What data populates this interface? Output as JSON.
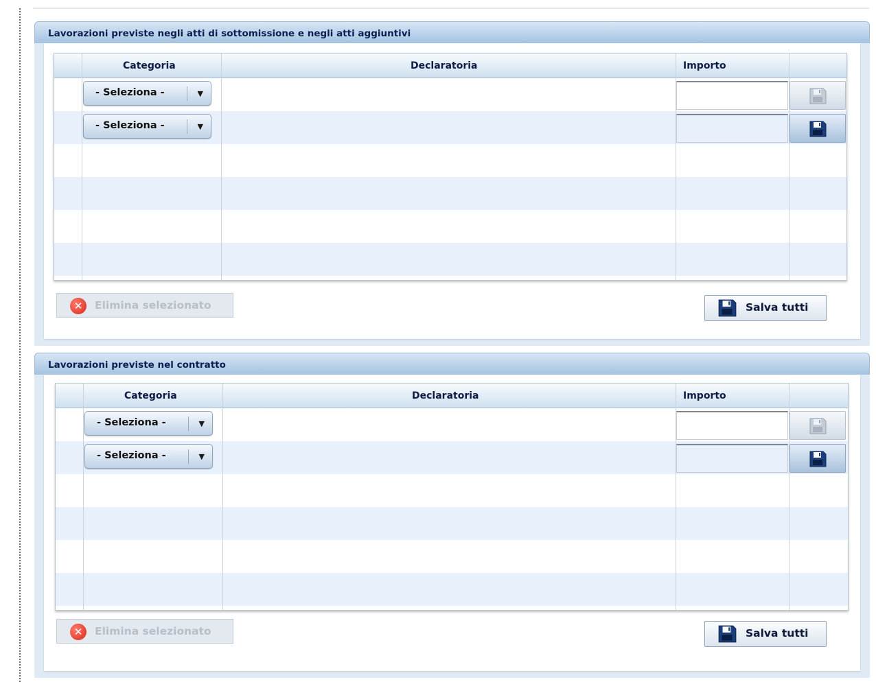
{
  "panels": [
    {
      "title": "Lavorazioni previste negli atti di sottomissione e negli atti aggiuntivi",
      "columns": {
        "categoria": "Categoria",
        "declaratoria": "Declaratoria",
        "importo": "Importo"
      },
      "rows": [
        {
          "categoria": "- Seleziona -",
          "importo": ""
        },
        {
          "categoria": "- Seleziona -",
          "importo": ""
        }
      ],
      "delete_label": "Elimina selezionato",
      "save_all_label": "Salva tutti"
    },
    {
      "title": "Lavorazioni previste nel contratto",
      "columns": {
        "categoria": "Categoria",
        "declaratoria": "Declaratoria",
        "importo": "Importo"
      },
      "rows": [
        {
          "categoria": "- Seleziona -",
          "importo": ""
        },
        {
          "categoria": "- Seleziona -",
          "importo": ""
        }
      ],
      "delete_label": "Elimina selezionato",
      "save_all_label": "Salva tutti"
    }
  ],
  "icons": {
    "row_save": "floppy-disk-icon",
    "delete": "delete-circle-icon",
    "save_all": "floppy-disk-icon"
  },
  "colors": {
    "header_text": "#0c1f52",
    "panel_bg": "#dfeaf5",
    "alt_row": "#e8f1fb",
    "disabled_text": "#b7bfc9",
    "delete_icon": "#d4281b"
  }
}
